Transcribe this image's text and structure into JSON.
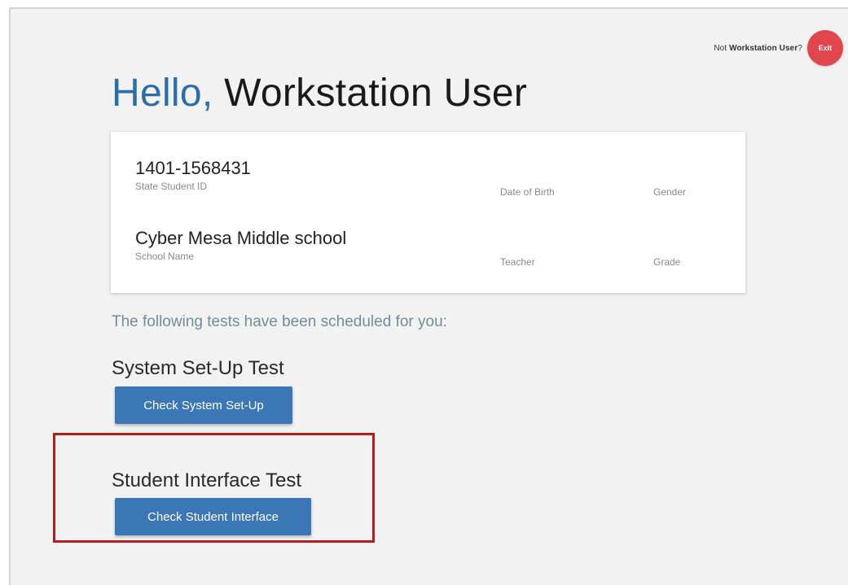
{
  "header": {
    "not_prefix": "Not ",
    "user_name": "Workstation User",
    "not_suffix": "?",
    "exit_label": "Exit"
  },
  "greeting": {
    "hello": "Hello,",
    "name": "Workstation User"
  },
  "student_info": {
    "student_id": "1401-1568431",
    "student_id_label": "State Student ID",
    "dob_label": "Date of Birth",
    "gender_label": "Gender",
    "school_name": "Cyber Mesa Middle school",
    "school_name_label": "School Name",
    "teacher_label": "Teacher",
    "grade_label": "Grade"
  },
  "tests": {
    "intro": "The following tests have been scheduled for you:",
    "system_title": "System Set-Up Test",
    "system_button": "Check System Set-Up",
    "student_title": "Student Interface Test",
    "student_button": "Check Student Interface"
  },
  "colors": {
    "hello_blue": "#2a6fa8",
    "button_blue": "#3b76b7",
    "exit_red": "#e0464c",
    "highlight_red": "#b81c1c"
  }
}
